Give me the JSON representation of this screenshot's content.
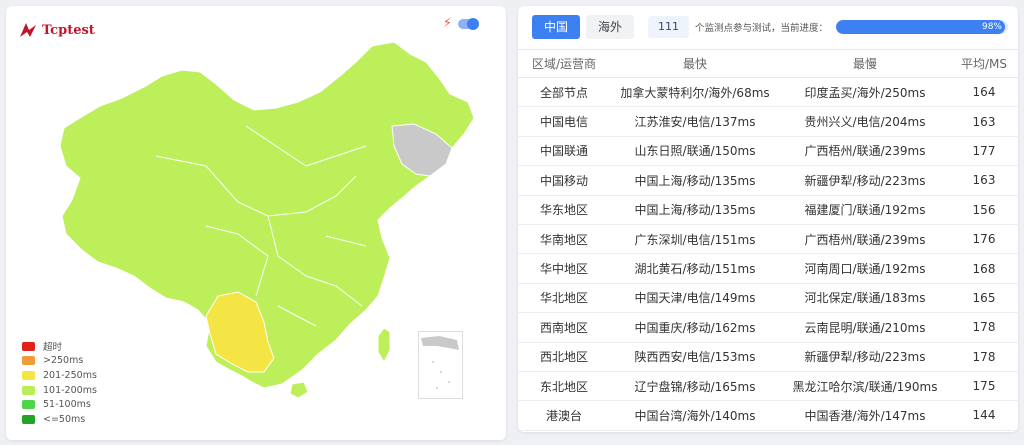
{
  "brand": {
    "logo_text": "Tcptest"
  },
  "legend": [
    {
      "label": "超时",
      "color": "#e0221b"
    },
    {
      "label": ">250ms",
      "color": "#f29b38"
    },
    {
      "label": "201-250ms",
      "color": "#f4e545"
    },
    {
      "label": "101-200ms",
      "color": "#b9ef56"
    },
    {
      "label": "51-100ms",
      "color": "#4fd54a"
    },
    {
      "label": "<=50ms",
      "color": "#25a227"
    }
  ],
  "map_colors": {
    "main": "#bcef5a",
    "yunnan": "#f4e545",
    "jilin": "#c9c9c9",
    "border": "#ffffff"
  },
  "tabs": {
    "domestic": "中国",
    "overseas": "海外"
  },
  "progress": {
    "count": "111",
    "text": "个监测点参与测试，当前进度：",
    "percent_label": "98%",
    "value": 98
  },
  "table": {
    "headers": [
      "区域/运营商",
      "最快",
      "最慢",
      "平均/MS"
    ],
    "rows": [
      [
        "全部节点",
        "加拿大蒙特利尔/海外/68ms",
        "印度孟买/海外/250ms",
        "164"
      ],
      [
        "中国电信",
        "江苏淮安/电信/137ms",
        "贵州兴义/电信/204ms",
        "163"
      ],
      [
        "中国联通",
        "山东日照/联通/150ms",
        "广西梧州/联通/239ms",
        "177"
      ],
      [
        "中国移动",
        "中国上海/移动/135ms",
        "新疆伊犁/移动/223ms",
        "163"
      ],
      [
        "华东地区",
        "中国上海/移动/135ms",
        "福建厦门/联通/192ms",
        "156"
      ],
      [
        "华南地区",
        "广东深圳/电信/151ms",
        "广西梧州/联通/239ms",
        "176"
      ],
      [
        "华中地区",
        "湖北黄石/移动/151ms",
        "河南周口/联通/192ms",
        "168"
      ],
      [
        "华北地区",
        "中国天津/电信/149ms",
        "河北保定/联通/183ms",
        "165"
      ],
      [
        "西南地区",
        "中国重庆/移动/162ms",
        "云南昆明/联通/210ms",
        "178"
      ],
      [
        "西北地区",
        "陕西西安/电信/153ms",
        "新疆伊犁/移动/223ms",
        "178"
      ],
      [
        "东北地区",
        "辽宁盘锦/移动/165ms",
        "黑龙江哈尔滨/联通/190ms",
        "175"
      ],
      [
        "港澳台",
        "中国台湾/海外/140ms",
        "中国香港/海外/147ms",
        "144"
      ]
    ]
  }
}
